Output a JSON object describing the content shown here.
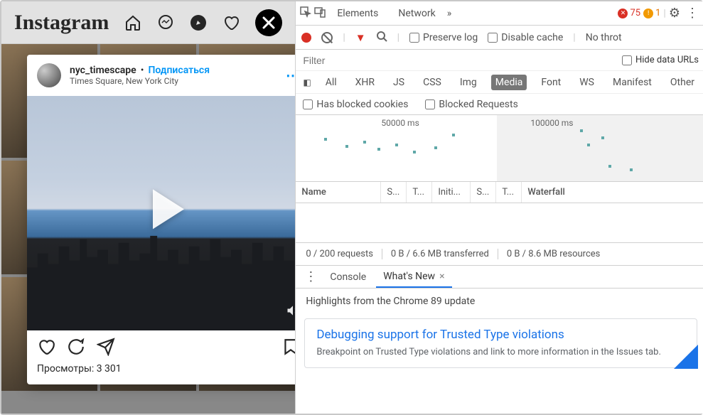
{
  "ig": {
    "logo": "Instagram",
    "username": "nyc_timescape",
    "subscribe": "Подписаться",
    "location": "Times Square, New York City",
    "views_label": "Просмотры: 3 301"
  },
  "devtools": {
    "tabs": {
      "elements": "Elements",
      "network": "Network"
    },
    "errors": "75",
    "warnings": "1",
    "toolbar": {
      "preserve_log": "Preserve log",
      "disable_cache": "Disable cache",
      "no_throttle": "No throt"
    },
    "filter_placeholder": "Filter",
    "hide_data_urls": "Hide data URLs",
    "types": {
      "all": "All",
      "xhr": "XHR",
      "js": "JS",
      "css": "CSS",
      "img": "Img",
      "media": "Media",
      "font": "Font",
      "ws": "WS",
      "manifest": "Manifest",
      "other": "Other"
    },
    "blocked_cookies": "Has blocked cookies",
    "blocked_requests": "Blocked Requests",
    "timeline": {
      "t1": "50000 ms",
      "t2": "100000 ms"
    },
    "columns": {
      "name": "Name",
      "status": "S...",
      "type": "T...",
      "initiator": "Initi...",
      "size": "S...",
      "time": "T...",
      "waterfall": "Waterfall"
    },
    "status": {
      "requests": "0 / 200 requests",
      "transferred": "0 B / 6.6 MB transferred",
      "resources": "0 B / 8.6 MB resources"
    },
    "drawer": {
      "console": "Console",
      "whats_new": "What's New",
      "highlights": "Highlights from the Chrome 89 update",
      "card_title": "Debugging support for Trusted Type violations",
      "card_body": "Breakpoint on Trusted Type violations and link to more information in the Issues tab."
    }
  }
}
